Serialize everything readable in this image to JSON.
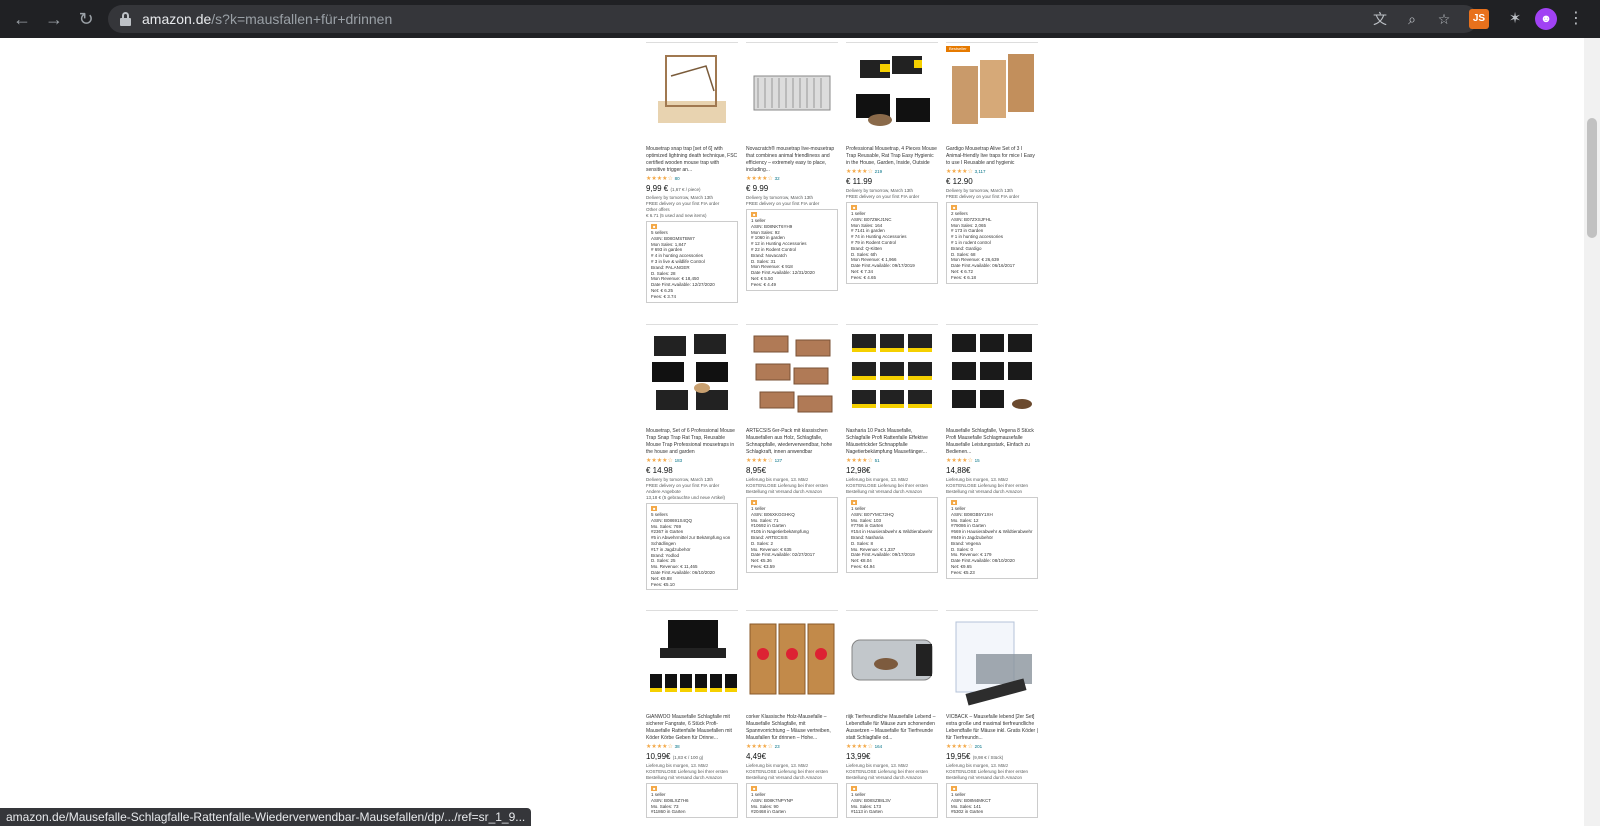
{
  "browser": {
    "url_host": "amazon.de",
    "url_path": "/s?k=mausfallen+für+drinnen",
    "ext_js": "JS",
    "status_url": "amazon.de/Mausefalle-Schlagfalle-Rattenfalle-Wiederverwendbar-Mausefallen/dp/.../ref=sr_1_9..."
  },
  "products": [
    {
      "title": "Mousetrap snap trap [set of 6] with optimized lightning death technique, FSC certified wooden mouse trap with sensitive trigger an...",
      "reviews": "80",
      "price": "9,99 €",
      "unit_price": "(1,67 € / piece)",
      "delivery": "Delivery by tomorrow, March 13th",
      "delivery_note": "FREE delivery on your first FIA order",
      "extra": "Other offers",
      "extra2": "€ 6.71 (5 used and new items)",
      "panel": [
        "5 sellers",
        "ASIN: B08GMSTBW7",
        "Mon Sales: 1,847",
        "# 693 in garden",
        "# 4 in hunting accessories",
        "# 3 in live & wildlife Control",
        "Brand: PALANGER",
        "D. Sales: 28",
        "Mon Revenue: € 18,450",
        "Date First Available: 12/27/2020",
        "Net: € 6.25",
        "Fees: € 3.74"
      ]
    },
    {
      "title": "Novacratch® mousetrap live-mousetrap that combines animal friendliness and efficiency – extremely easy to place, including...",
      "reviews": "32",
      "price": "€ 9.99",
      "unit_price": "",
      "delivery": "Delivery by tomorrow, March 13th",
      "delivery_note": "FREE delivery on your first FIA order",
      "extra": "",
      "extra2": "",
      "panel": [
        "1 seller",
        "ASIN: B08NKT6YH9",
        "Mon Sales: 92",
        "# 1060 in garden",
        "# 12 in Hunting Accessories",
        "# 22 in Rodent Control",
        "Brand: Novacatch",
        "D. Sales: 31",
        "Mon Revenue: € 918",
        "Date First Available: 12/31/2020",
        "Net: € 5.50",
        "Fees: € 4.49"
      ]
    },
    {
      "title": "Professional Mousetrap, 4 Pieces Mouse Trap Reusable, Rat Trap Easy Hygienic in the House, Garden, Inside, Outside",
      "reviews": "219",
      "price": "€ 11.99",
      "unit_price": "",
      "delivery": "Delivery by tomorrow, March 13th",
      "delivery_note": "FREE delivery on your first FIA order",
      "extra": "",
      "extra2": "",
      "panel": [
        "1 seller",
        "ASIN: B07Z6KJ1NC",
        "Mon Sales: 164",
        "# 7141 in garden",
        "# 74 in Hunting Accessories",
        "# 79 in Rodent Control",
        "Brand: Q-Kitten",
        "D. Sales: 6th",
        "Mon Revenue: € 1,966",
        "Date First Available: 09/17/2019",
        "Net: € 7.34",
        "Fees: € 4.65"
      ]
    },
    {
      "title": "Gardigo Mousetrap Alive Set of 3 I Animal-friendly live traps for mice I Easy to use I Reusable and hygienic",
      "reviews": "3,117",
      "price": "€ 12.90",
      "unit_price": "",
      "bestseller": "Bestseller",
      "delivery": "Delivery by tomorrow, March 13th",
      "delivery_note": "FREE delivery on your first FIA order",
      "extra": "",
      "extra2": "",
      "panel": [
        "2 sellers",
        "ASIN: B07ZXSJFHL",
        "Mon Sales: 2,065",
        "# 173 in Garden",
        "# 1 in hunting accessories",
        "# 1 in rodent control",
        "Brand: Gardigo",
        "D. Sales: 68",
        "Mon Revenue: € 26,639",
        "Date First Available: 06/16/2017",
        "Net: € 6.72",
        "Fees: € 6.18"
      ]
    },
    {
      "title": "Mousetrap, Set of 6 Professional Mouse Trap Snap Trap Rat Trap, Reusable Mouse Trap Professional mousetraps in the house and garden",
      "reviews": "183",
      "price": "€ 14.98",
      "unit_price": "",
      "delivery": "Delivery by tomorrow, March 13th",
      "delivery_note": "FREE delivery on your first FIA order",
      "extra": "Andere Angebote",
      "extra2": "13,18 € (5 gebrauchte und neue Artikel)",
      "panel": [
        "5 sellers",
        "ASIN: B08691S4QQ",
        "Mo. Sales: 769",
        "#2367 in Garten",
        "#5 in Abwehrmittel zur Bekämpfung von Schädlingen",
        "#17 in Jagdzubehör",
        "Brand: Yodlod",
        "D. Sales: 25",
        "Mo. Revenue: € 11,465",
        "Date First Available: 06/10/2020",
        "Net: €9.88",
        "Fees: €5.10"
      ]
    },
    {
      "title": "ARTECSIS 6er-Pack mit klassischen Mausefallen aus Holz, Schlagfalle, Schnappfalle, wiederverwendbar, hohe Schlagkraft, innen anwendbar",
      "reviews": "127",
      "price": "8,95€",
      "unit_price": "",
      "delivery": "Lieferung bis morgen, 13. März",
      "delivery_note": "KOSTENLOSE Lieferung bei Ihrer ersten Bestellung mit Versand durch Amazon",
      "extra": "",
      "extra2": "",
      "panel": [
        "1 seller",
        "ASIN: B06XKGGHKQ",
        "Mo. Sales: 71",
        "#10692 in Garten",
        "#105 in Nagetierbekämpfung",
        "Brand: ARTECSIS",
        "D. Sales: 2",
        "Mo. Revenue: € 635",
        "Date First Available: 02/27/2017",
        "Net: €5.36",
        "Fees: €3.59"
      ]
    },
    {
      "title": "Nasharia 10 Pack Mausefalle, Schlagfalle Profi Rattenfalle Effektive Mäusetrickder Schnappfalle Nagetierbekämpfung Mausefänger...",
      "reviews": "51",
      "price": "12,98€",
      "unit_price": "",
      "delivery": "Lieferung bis morgen, 13. März",
      "delivery_note": "KOSTENLOSE Lieferung bei Ihrer ersten Bestellung mit Versand durch Amazon",
      "extra": "",
      "extra2": "",
      "panel": [
        "1 seller",
        "ASIN: B07YMC72HQ",
        "Mo. Sales: 103",
        "#7766 in Garten",
        "#154 in Hausierabwehr & Wildtierabwehr",
        "Brand: Nasharia",
        "D. Sales: 8",
        "Mo. Revenue: € 1,337",
        "Date First Available: 09/17/2019",
        "Net: €8.04",
        "Fees: €4.94"
      ]
    },
    {
      "title": "Mausefalle Schlagfalle, Vegena 8 Stück Profi Mausefalle Schlagmausefalle Mausefalle Leistungsstark, Einfach zu Bedienen...",
      "reviews": "15",
      "price": "14,88€",
      "unit_price": "",
      "delivery": "Lieferung bis morgen, 13. März",
      "delivery_note": "KOSTENLOSE Lieferung bei Ihrer ersten Bestellung mit Versand durch Amazon",
      "extra": "",
      "extra2": "",
      "panel": [
        "1 seller",
        "ASIN: B08GB5Y1XH",
        "Mo. Sales: 12",
        "#79086 in Garten",
        "#669 in Hausierabwehr & Wildtierabwehr",
        "#849 in Jagdzubehör",
        "Brand: Vegena",
        "D. Sales: 0",
        "Mo. Revenue: € 179",
        "Date First Available: 08/10/2020",
        "Net: €9.65",
        "Fees: €5.23"
      ]
    },
    {
      "title": "GiANWOO Mausefalle Schlagfalle mit sicherer Fangrate, 6 Stück Profi-Mausefalle Rattenfalle Mausefallen mit Köder Körbe Geben für Drinne...",
      "reviews": "38",
      "price": "10,99€",
      "unit_price": "(1,83 € / 100 g)",
      "delivery": "Lieferung bis morgen, 13. März",
      "delivery_note": "KOSTENLOSE Lieferung bei Ihrer ersten Bestellung mit Versand durch Amazon",
      "extra": "",
      "extra2": "",
      "panel": [
        "1 seller",
        "ASIN: B08LXZ7H6",
        "Mo. Sales: 73",
        "#11860 in Garten"
      ]
    },
    {
      "title": "corker Klassische Holz-Mausefalle – Mausefalle Schlagfalle, mit Spannvorrichtung – Mäuse vertreiben, Mausfallen für drinnen – Hohe...",
      "reviews": "23",
      "price": "4,49€",
      "unit_price": "",
      "delivery": "Lieferung bis morgen, 13. März",
      "delivery_note": "KOSTENLOSE Lieferung bei Ihrer ersten Bestellung mit Versand durch Amazon",
      "extra": "",
      "extra2": "",
      "panel": [
        "1 seller",
        "ASIN: B08K7NPYNP",
        "Mo. Sales: 90",
        "#20468 in Garten"
      ]
    },
    {
      "title": "riijk Tierfreundliche Mausefalle Lebend – Lebendfalle für Mäuse zum schonenden Aussetzen – Mausefalle für Tierfreunde statt Schlagfalle od...",
      "reviews": "164",
      "price": "13,99€",
      "unit_price": "",
      "delivery": "Lieferung bis morgen, 13. März",
      "delivery_note": "KOSTENLOSE Lieferung bei Ihrer ersten Bestellung mit Versand durch Amazon",
      "extra": "",
      "extra2": "",
      "panel": [
        "1 seller",
        "ASIN: B08SZ88L3V",
        "Mo. Sales: 173",
        "#1113 in Garten"
      ]
    },
    {
      "title": "VICBACK – Mausefalle lebend [2er Set] extra große und maximal tierfreundliche Lebendfalle für Mäuse inkl. Gratis Köder | für Tierfreundn...",
      "reviews": "201",
      "price": "19,95€",
      "unit_price": "(9,98 € / Stück)",
      "delivery": "Lieferung bis morgen, 13. März",
      "delivery_note": "KOSTENLOSE Lieferung bei Ihrer ersten Bestellung mit Versand durch Amazon",
      "extra": "",
      "extra2": "",
      "panel": [
        "1 seller",
        "ASIN: B08M4MKCT",
        "Mo. Sales: 141",
        "#5302 in Garten"
      ]
    }
  ]
}
